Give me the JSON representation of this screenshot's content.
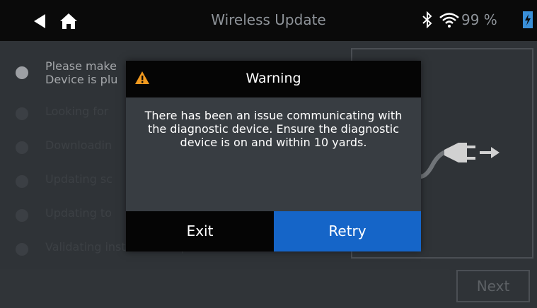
{
  "header": {
    "title": "Wireless Update",
    "battery_text": "99 %",
    "icons": {
      "back": "back-arrow-icon",
      "home": "home-icon",
      "bluetooth": "bluetooth-icon",
      "wifi": "wifi-icon",
      "battery": "battery-charging-icon"
    }
  },
  "steps": [
    {
      "label": "Please make\nDevice is plu",
      "state": "active"
    },
    {
      "label": "Looking for",
      "state": "pending"
    },
    {
      "label": "Downloadin",
      "state": "pending"
    },
    {
      "label": "Updating sc",
      "state": "pending"
    },
    {
      "label": "Updating to",
      "state": "pending"
    },
    {
      "label": "Validating installed components",
      "state": "pending"
    }
  ],
  "illustration": {
    "icon": "plug-cable-icon"
  },
  "footer": {
    "next_label": "Next"
  },
  "dialog": {
    "title": "Warning",
    "icon": "warning-icon",
    "message": "There has been an issue communicating with the diagnostic device. Ensure the diagnostic device is on and within 10 yards.",
    "exit_label": "Exit",
    "retry_label": "Retry"
  },
  "colors": {
    "accent": "#1565c8",
    "warning": "#f29a1f",
    "battery": "#3a8fd8"
  }
}
